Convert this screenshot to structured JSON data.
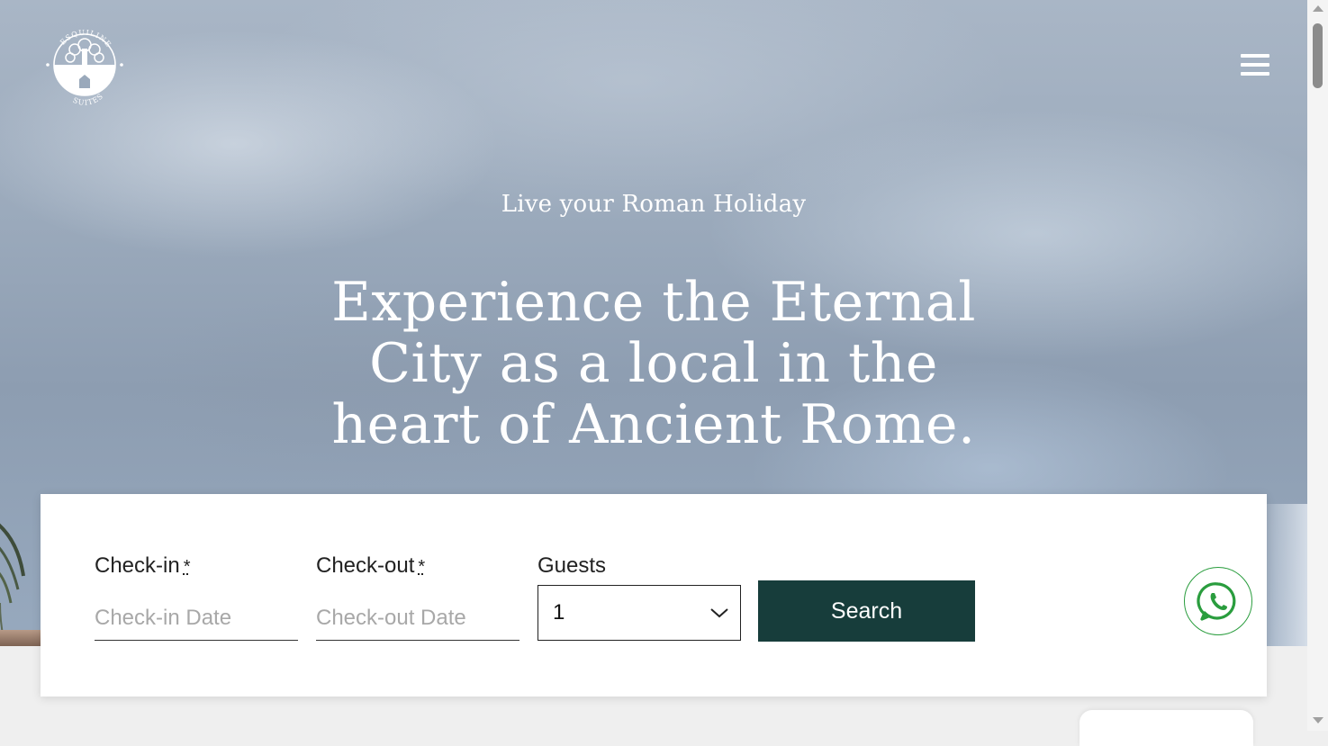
{
  "header": {
    "logo_text_top": "ESQUILINE",
    "logo_text_bottom": "SUITES",
    "menu_icon": "hamburger-menu-icon"
  },
  "hero": {
    "tagline": "Live your Roman Holiday",
    "headline": "Experience the Eternal City as a local in the heart of Ancient Rome."
  },
  "booking": {
    "checkin_label": "Check-in",
    "checkin_required": "*",
    "checkin_placeholder": "Check-in Date",
    "checkout_label": "Check-out",
    "checkout_required": "*",
    "checkout_placeholder": "Check-out Date",
    "guests_label": "Guests",
    "guests_value": "1",
    "search_label": "Search"
  },
  "floating": {
    "whatsapp_icon": "whatsapp-icon"
  },
  "colors": {
    "primary": "#173d3b",
    "whatsapp_green": "#2a9d3e"
  }
}
